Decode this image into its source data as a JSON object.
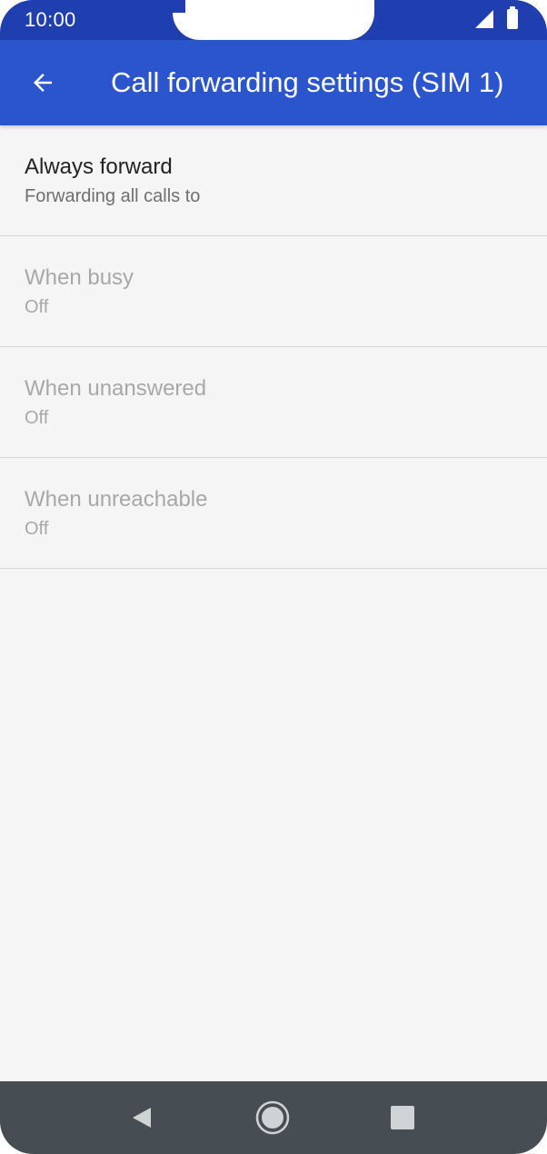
{
  "status_bar": {
    "time": "10:00",
    "icons": [
      "signal-icon",
      "battery-icon"
    ]
  },
  "app_bar": {
    "back_icon": "arrow-back-icon",
    "title": "Call forwarding settings (SIM 1)"
  },
  "items": [
    {
      "title": "Always forward",
      "summary": "Forwarding all calls to",
      "enabled": true
    },
    {
      "title": "When busy",
      "summary": "Off",
      "enabled": false
    },
    {
      "title": "When unanswered",
      "summary": "Off",
      "enabled": false
    },
    {
      "title": "When unreachable",
      "summary": "Off",
      "enabled": false
    }
  ],
  "nav_bar": {
    "icons": [
      "nav-back-icon",
      "nav-home-icon",
      "nav-recents-icon"
    ]
  },
  "colors": {
    "status_bar": "#1f3fb0",
    "app_bar": "#2b55cc",
    "background": "#f5f5f5",
    "nav_bar": "#464e53"
  }
}
